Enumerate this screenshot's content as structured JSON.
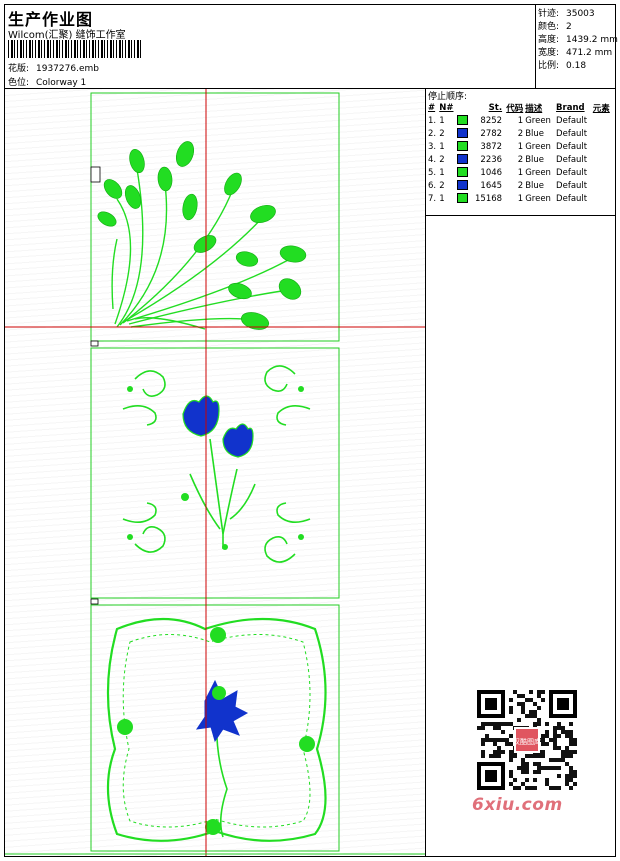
{
  "header": {
    "title": "生产作业图",
    "company": "Wilcom(汇聚) 缝饰工作室",
    "design_label": "花版:",
    "design_value": "1937276.emb",
    "colorway_label": "色位:",
    "colorway_value": "Colorway 1"
  },
  "stats": [
    {
      "label": "针迹:",
      "value": "35003"
    },
    {
      "label": "颜色:",
      "value": "2"
    },
    {
      "label": "高度:",
      "value": "1439.2 mm"
    },
    {
      "label": "宽度:",
      "value": "471.2 mm"
    },
    {
      "label": "比例:",
      "value": "0.18"
    }
  ],
  "stop_sequence": {
    "title": "停止顺序:",
    "headers": [
      "#",
      "N#",
      "",
      "St.",
      "代码",
      "描述",
      "Brand",
      "元素"
    ],
    "rows": [
      {
        "num": "1.",
        "n": "1",
        "color": "#22dd22",
        "st": "8252",
        "code": "1",
        "desc": "Green",
        "brand": "Default"
      },
      {
        "num": "2.",
        "n": "2",
        "color": "#1133cc",
        "st": "2782",
        "code": "2",
        "desc": "Blue",
        "brand": "Default"
      },
      {
        "num": "3.",
        "n": "1",
        "color": "#22dd22",
        "st": "3872",
        "code": "1",
        "desc": "Green",
        "brand": "Default"
      },
      {
        "num": "4.",
        "n": "2",
        "color": "#1133cc",
        "st": "2236",
        "code": "2",
        "desc": "Blue",
        "brand": "Default"
      },
      {
        "num": "5.",
        "n": "1",
        "color": "#22dd22",
        "st": "1046",
        "code": "1",
        "desc": "Green",
        "brand": "Default"
      },
      {
        "num": "6.",
        "n": "2",
        "color": "#1133cc",
        "st": "1645",
        "code": "2",
        "desc": "Blue",
        "brand": "Default"
      },
      {
        "num": "7.",
        "n": "1",
        "color": "#22dd22",
        "st": "15168",
        "code": "1",
        "desc": "Green",
        "brand": "Default"
      }
    ]
  },
  "colors": {
    "thread_green": "#22dd22",
    "thread_blue": "#1133cc",
    "crosshair": "#cc0000"
  },
  "watermark": {
    "qr_text": "汉酷图库",
    "site": "6xiu.com"
  }
}
